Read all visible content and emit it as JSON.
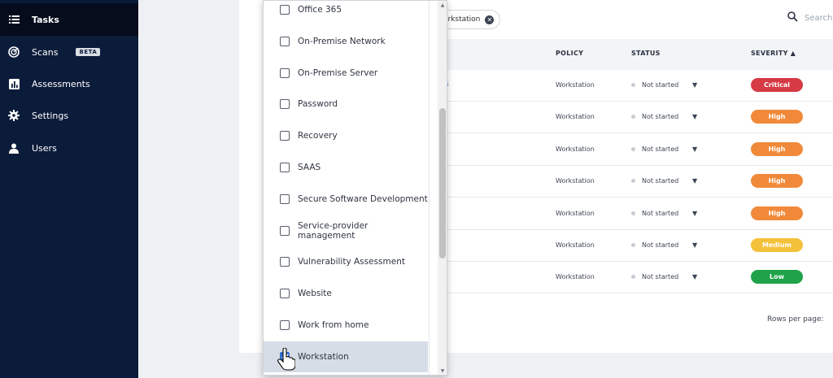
{
  "sidebar": {
    "items": [
      {
        "label": "Tasks",
        "icon": "list-icon",
        "active": true
      },
      {
        "label": "Scans",
        "icon": "radar-icon",
        "badge": "BETA"
      },
      {
        "label": "Assessments",
        "icon": "bar-chart-icon"
      },
      {
        "label": "Settings",
        "icon": "gear-icon"
      },
      {
        "label": "Users",
        "icon": "user-icon"
      }
    ]
  },
  "filter_chip": {
    "label": "orkstation"
  },
  "search": {
    "placeholder": "Search..."
  },
  "table": {
    "headers": {
      "policy": "POLICY",
      "status": "STATUS",
      "severity": "SEVERITY"
    },
    "rows": [
      {
        "policy": "Workstation",
        "status": "Not started",
        "severity": "Critical"
      },
      {
        "policy": "Workstation",
        "status": "Not started",
        "severity": "High"
      },
      {
        "policy": "Workstation",
        "status": "Not started",
        "severity": "High"
      },
      {
        "policy": "Workstation",
        "status": "Not started",
        "severity": "High"
      },
      {
        "policy": "Workstation",
        "status": "Not started",
        "severity": "High"
      },
      {
        "policy": "Workstation",
        "status": "Not started",
        "severity": "Medium"
      },
      {
        "policy": "Workstation",
        "status": "Not started",
        "severity": "Low"
      }
    ],
    "first_row_link_fragment": "s"
  },
  "pagination": {
    "rows_per_page_label": "Rows per page:"
  },
  "dropdown": {
    "options": [
      {
        "label": "Office 365",
        "checked": false
      },
      {
        "label": "On-Premise Network",
        "checked": false
      },
      {
        "label": "On-Premise Server",
        "checked": false
      },
      {
        "label": "Password",
        "checked": false
      },
      {
        "label": "Recovery",
        "checked": false
      },
      {
        "label": "SAAS",
        "checked": false
      },
      {
        "label": "Secure Software Development",
        "checked": false
      },
      {
        "label": "Service-provider management",
        "checked": false
      },
      {
        "label": "Vulnerability Assessment",
        "checked": false
      },
      {
        "label": "Website",
        "checked": false
      },
      {
        "label": "Work from home",
        "checked": false
      },
      {
        "label": "Workstation",
        "checked": true
      }
    ]
  },
  "colors": {
    "sidebar_bg": "#0b1b3a",
    "critical": "#d63a45",
    "high": "#f08a3a",
    "medium": "#f4c23a",
    "low": "#1fa34a",
    "checkbox_checked": "#2f6fd1"
  }
}
